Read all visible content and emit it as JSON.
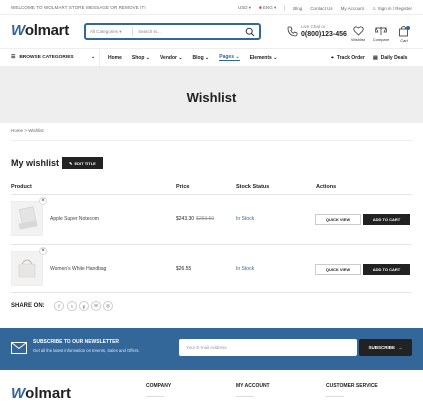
{
  "topbar": {
    "welcome": "WELCOME TO WOLMART STORE MESSAGE OR REMOVE IT!",
    "currency": "USD",
    "language": "ENG",
    "links": [
      "Blog",
      "Contact Us",
      "My Account",
      "Sign in / Register"
    ]
  },
  "header": {
    "logo_prefix": "W",
    "logo_rest": "olmart",
    "search_category": "All Categories",
    "search_placeholder": "Search in...",
    "phone_label": "Live Chat or :",
    "phone_number": "0(800)123-456",
    "wishlist_label": "Wishlist",
    "compare_label": "Compare",
    "cart_label": "Cart",
    "cart_count": "0"
  },
  "nav": {
    "browse": "BROWSE CATEGORIES",
    "items": [
      "Home",
      "Shop",
      "Vendor",
      "Blog",
      "Pages",
      "Elements"
    ],
    "track": "Track Order",
    "deals": "Daily Deals"
  },
  "page": {
    "title": "Wishlist",
    "breadcrumb_home": "Home",
    "breadcrumb_sep": ">",
    "breadcrumb_current": "Wishlist",
    "heading": "My wishlist",
    "edit_label": "EDIT TITLE"
  },
  "table": {
    "headers": [
      "Product",
      "Price",
      "Stock Status",
      "Actions"
    ],
    "rows": [
      {
        "name": "Apple Super Notecom",
        "price": "$243.30",
        "old_price": "$253.50",
        "stock": "In Stock",
        "quick": "QUICK VIEW",
        "cart": "ADD TO CART"
      },
      {
        "name": "Women's White Handbag",
        "price": "$26.55",
        "old_price": "",
        "stock": "In Stock",
        "quick": "QUICK VIEW",
        "cart": "ADD TO CART"
      }
    ]
  },
  "share": {
    "label": "SHARE ON:",
    "icons": [
      "f",
      "t",
      "p",
      "✉",
      "◎"
    ]
  },
  "newsletter": {
    "title": "SUBSCRIBE TO OUR NEWSLETTER",
    "subtitle": "Get all the latest information on Events, Sales and Offers.",
    "placeholder": "Your E-mail Address",
    "button": "SUBSCRIBE"
  },
  "footer": {
    "logo_prefix": "W",
    "logo_rest": "olmart",
    "columns": [
      "COMPANY",
      "MY ACCOUNT",
      "CUSTOMER SERVICE"
    ]
  },
  "colors": {
    "accent": "#336699",
    "dark": "#222222"
  }
}
